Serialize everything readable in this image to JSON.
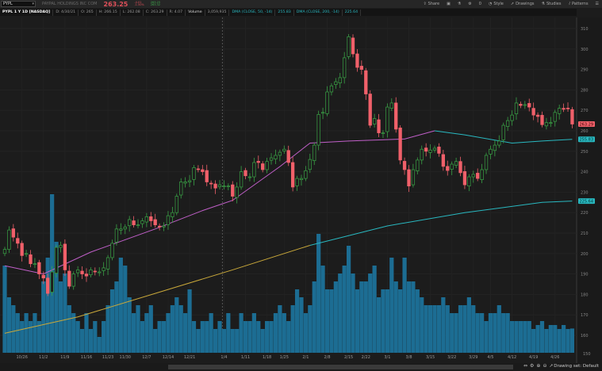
{
  "header": {
    "symbol": "PYPL",
    "company": "PAYPAL HOLDINGS INC COM",
    "last": "263.25",
    "net_change": "-4.01",
    "net_change_pct": "-1.50%",
    "bid": "263.25",
    "ask": "263.32"
  },
  "toolbar": {
    "share": "Share",
    "style": "Style",
    "drawings": "Drawings",
    "studies": "Studies",
    "patterns": "Patterns",
    "alerts_count": "0"
  },
  "legend": {
    "title": "PYPL 1 Y 1D [NASDAQ]",
    "date": "D: 4/30/21",
    "open": "O: 265",
    "high": "H: 266.15",
    "low": "L: 262.08",
    "close": "C: 263.29",
    "range": "R: 4.07",
    "volume_label": "Volume",
    "volume": "3,059,935",
    "dma50_label": "DMA (CLOSE, 50, -14)",
    "dma50": "255.83",
    "dma200_label": "DMA (CLOSE, 200, -14)",
    "dma200": "225.64"
  },
  "footer": {
    "drawing_set": "Drawing set: Default"
  },
  "colors": {
    "up": "#3aa346",
    "down": "#f0606a",
    "volume": "#1c6d93",
    "dma50_up": "#c05fc8",
    "dma50_down": "#29b8c0",
    "dma200_up": "#c9a83a",
    "dma200_down": "#29b8c0",
    "background": "#1c1c1c"
  },
  "chart_data": {
    "type": "candlestick",
    "ylim": [
      150,
      315
    ],
    "y_ticks": [
      160,
      170,
      180,
      190,
      200,
      210,
      220,
      230,
      240,
      250,
      260,
      270,
      280,
      290,
      300,
      310
    ],
    "x_tick_labels": [
      "10/26",
      "11/2",
      "11/9",
      "11/16",
      "11/23",
      "11/30",
      "12/7",
      "12/14",
      "12/21",
      "1/4",
      "1/11",
      "1/18",
      "1/25",
      "2/1",
      "2/8",
      "2/15",
      "2/22",
      "3/1",
      "3/8",
      "3/15",
      "3/22",
      "3/29",
      "4/5",
      "4/12",
      "4/19",
      "4/26"
    ],
    "price_labels": {
      "close": "263.29",
      "dma50": "255.83",
      "dma200": "225.64",
      "volume_axis": "150"
    },
    "close": [
      202,
      211.5,
      208,
      205,
      199,
      200,
      195,
      195,
      190,
      188,
      180.5,
      191,
      203,
      204,
      192,
      184,
      190,
      192,
      190,
      189,
      192,
      191,
      191,
      193,
      198,
      205,
      212,
      212,
      213,
      216.6,
      214,
      214,
      216,
      218,
      216,
      214,
      213,
      213.5,
      218.5,
      220,
      228,
      235,
      235,
      235.6,
      242,
      241,
      240,
      235,
      234,
      232,
      233.6,
      233,
      233,
      228,
      232.5,
      240,
      238,
      237.5,
      244.5,
      244.5,
      241,
      245,
      246.8,
      248,
      249.5,
      251,
      244.5,
      232.5,
      236.7,
      236.7,
      240.5,
      246,
      253,
      268,
      269,
      279,
      282,
      284,
      286,
      295.7,
      306,
      297.6,
      291,
      290,
      278,
      262.7,
      266,
      259,
      259,
      271.6,
      273.6,
      260.8,
      245.7,
      241,
      233,
      241,
      245.7,
      251,
      250,
      250.6,
      251.5,
      249,
      242.6,
      240.6,
      243.7,
      245,
      239.5,
      233.6,
      237.5,
      238.7,
      236.7,
      241,
      248,
      251,
      253,
      255,
      262.7,
      265,
      267.7,
      273.6,
      272.4,
      272.8,
      271.6,
      267.7,
      267,
      263,
      264,
      264,
      269,
      271,
      270.5,
      271,
      263.29
    ],
    "volume_millions": [
      11,
      7,
      6,
      5,
      4,
      5,
      4,
      5,
      4,
      9,
      12,
      20,
      14,
      9,
      10,
      6,
      5,
      4,
      3,
      5,
      3,
      4,
      2,
      4,
      6,
      8,
      9,
      12,
      11,
      7,
      5,
      6,
      4,
      5,
      6,
      3,
      4,
      4,
      5,
      6,
      7,
      6,
      5,
      8,
      4,
      3,
      4,
      4,
      5,
      3,
      4,
      3,
      5,
      3,
      3,
      5,
      4,
      4,
      5,
      4,
      3,
      4,
      4,
      5,
      6,
      5,
      4,
      6,
      8,
      7,
      5,
      6,
      9,
      15,
      11,
      8,
      8,
      9,
      10,
      11,
      13.5,
      10,
      8,
      9,
      9,
      10,
      11,
      7,
      8,
      8,
      12,
      9,
      8,
      12,
      9,
      9,
      8,
      7,
      6,
      6,
      6,
      6,
      7,
      6,
      5,
      5,
      6,
      6,
      7,
      6,
      5,
      5,
      4,
      5,
      5,
      6,
      5,
      5,
      4,
      4,
      4,
      4,
      4,
      3,
      3.5,
      4,
      3,
      3.5,
      3.5,
      3,
      3.5,
      3,
      3.06
    ],
    "dma50_points": [
      [
        0,
        194
      ],
      [
        9,
        190
      ],
      [
        20,
        200.7
      ],
      [
        35,
        212
      ],
      [
        46,
        221
      ],
      [
        53,
        226
      ],
      [
        64,
        242.5
      ],
      [
        71,
        254
      ],
      [
        80,
        255
      ],
      [
        93,
        256
      ],
      [
        100,
        260
      ],
      [
        107,
        258
      ],
      [
        118,
        254
      ],
      [
        125,
        255
      ],
      [
        132,
        255.83
      ]
    ],
    "dma200_points": [
      [
        0,
        161
      ],
      [
        17,
        169
      ],
      [
        35,
        180.5
      ],
      [
        53,
        192
      ],
      [
        71,
        204
      ],
      [
        89,
        213.5
      ],
      [
        107,
        220
      ],
      [
        125,
        225
      ],
      [
        132,
        225.64
      ]
    ],
    "dma50_turn_index": 104,
    "dma200_turn_index": 88
  }
}
